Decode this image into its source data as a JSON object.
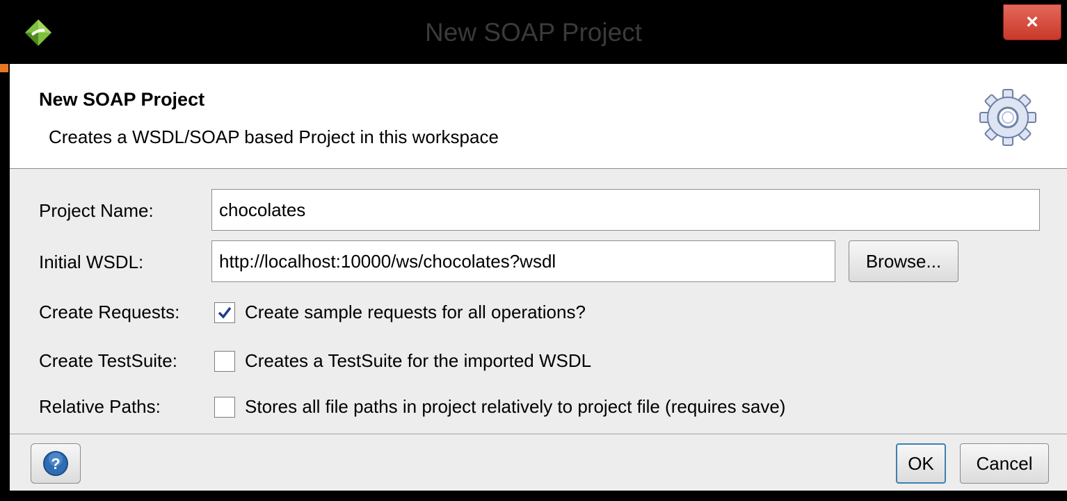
{
  "window": {
    "title": "New SOAP Project",
    "close_label": "×"
  },
  "header": {
    "title": "New SOAP Project",
    "description": "Creates a WSDL/SOAP based Project in this workspace"
  },
  "form": {
    "project_name": {
      "label": "Project Name:",
      "value": "chocolates"
    },
    "initial_wsdl": {
      "label": "Initial WSDL:",
      "value": "http://localhost:10000/ws/chocolates?wsdl",
      "browse_label": "Browse..."
    },
    "create_requests": {
      "label": "Create Requests:",
      "checked": true,
      "text": "Create sample requests for all operations?"
    },
    "create_testsuite": {
      "label": "Create TestSuite:",
      "checked": false,
      "text": "Creates a TestSuite for the imported WSDL"
    },
    "relative_paths": {
      "label": "Relative Paths:",
      "checked": false,
      "text": "Stores all file paths in project relatively to project file (requires save)"
    }
  },
  "footer": {
    "ok_label": "OK",
    "cancel_label": "Cancel"
  },
  "icons": {
    "app": "soapui-logo-icon",
    "header": "gear-icon",
    "help": "help-icon",
    "close": "close-icon"
  },
  "colors": {
    "titlebar": "#000000",
    "close_button": "#c9382a",
    "accent": "#e87722",
    "help_blue": "#2e6db4"
  }
}
